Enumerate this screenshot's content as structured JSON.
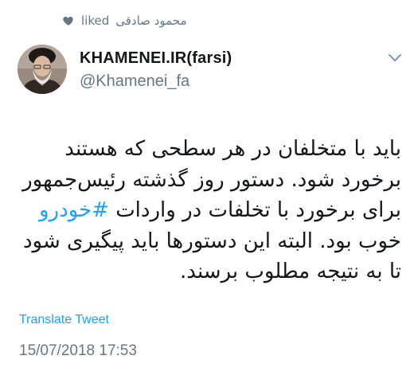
{
  "liked_banner": {
    "user": "محمود صادقی",
    "action": "liked",
    "icon": "heart-icon"
  },
  "author": {
    "display_name": "KHAMENEI.IR(farsi)",
    "handle": "@Khamenei_fa"
  },
  "tweet": {
    "lines": [
      "باید با متخلفان در هر سطحی که هستند",
      "برخورد شود. دستور روز گذشته رئیس‌جمهور",
      "برای برخورد با تخلفات در واردات",
      "خوب بود. البته این دستورها باید پیگیری شود",
      "تا به نتیجه مطلوب برسند."
    ],
    "hashtag": "#خودرو"
  },
  "translate_label": "Translate Tweet",
  "timestamp": "15/07/2018 17:53",
  "colors": {
    "link": "#1da1f2",
    "secondary": "#657786",
    "text": "#14171a"
  }
}
